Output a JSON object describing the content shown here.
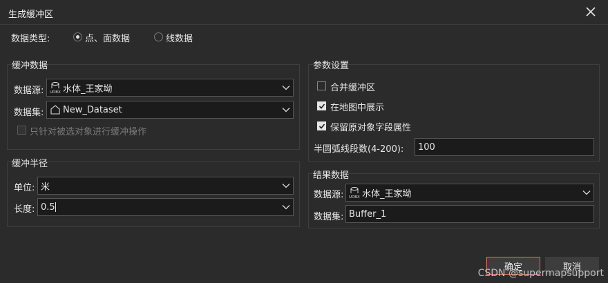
{
  "window": {
    "title": "生成缓冲区"
  },
  "data_type": {
    "label": "数据类型:",
    "options": [
      {
        "label": "点、面数据",
        "checked": true
      },
      {
        "label": "线数据",
        "checked": false
      }
    ]
  },
  "buffer_data": {
    "title": "缓冲数据",
    "datasource_label": "数据源:",
    "datasource_value": "水体_王家坳",
    "dataset_label": "数据集:",
    "dataset_value": "New_Dataset",
    "selected_only_label": "只针对被选对象进行缓冲操作",
    "selected_only_checked": false,
    "selected_only_enabled": false
  },
  "buffer_radius": {
    "title": "缓冲半径",
    "unit_label": "单位:",
    "unit_value": "米",
    "length_label": "长度:",
    "length_value": "0.5"
  },
  "params": {
    "title": "参数设置",
    "merge_label": "合并缓冲区",
    "merge_checked": false,
    "show_in_map_label": "在地图中展示",
    "show_in_map_checked": true,
    "keep_fields_label": "保留原对象字段属性",
    "keep_fields_checked": true,
    "segments_label": "半圆弧线段数(4-200):",
    "segments_value": "100"
  },
  "result": {
    "title": "结果数据",
    "datasource_label": "数据源:",
    "datasource_value": "水体_王家坳",
    "dataset_label": "数据集:",
    "dataset_value": "Buffer_1"
  },
  "buttons": {
    "ok": "确定",
    "cancel": "取消"
  },
  "watermark": "CSDN @supermapsupport",
  "icons": {
    "datasource": "udbx-datasource-icon",
    "dataset": "region-dataset-icon"
  }
}
